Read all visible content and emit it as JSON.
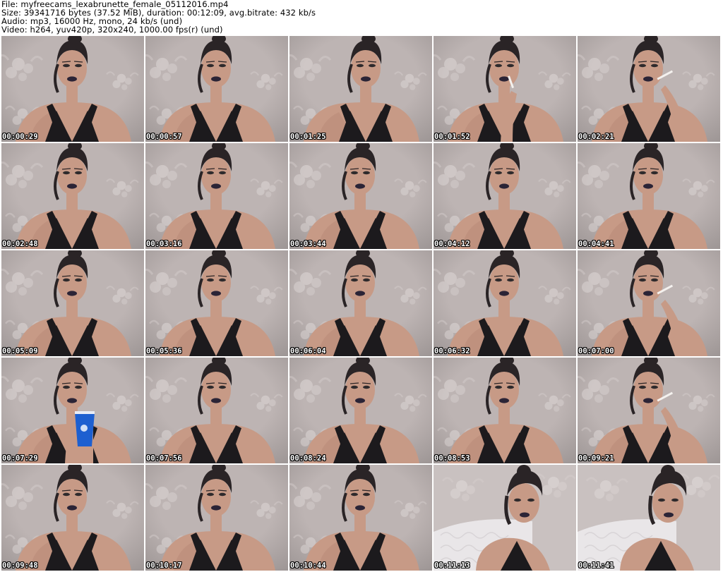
{
  "header": {
    "file_line": "File: myfreecams_lexabrunette_female_05112016.mp4",
    "size_line": "Size: 39341716 bytes (37.52 MiB), duration: 00:12:09, avg.bitrate: 432 kb/s",
    "audio_line": "Audio: mp3, 16000 Hz, mono, 24 kb/s (und)",
    "video_line": "Video: h264, yuv420p, 320x240, 1000.00 fps(r) (und)"
  },
  "colors": {
    "wall": "#bdb4b3",
    "wall_dark": "#a89e9c",
    "skin": "#c79a86",
    "skin_shadow": "#a77866",
    "hair": "#2a2426",
    "top": "#1c1a1d",
    "lips": "#2b2436",
    "headboard": "#e9e6e8",
    "cup": "#1d5fd0"
  },
  "thumbnails": [
    {
      "time": "00:00:29",
      "variant": "base"
    },
    {
      "time": "00:00:57",
      "variant": "base"
    },
    {
      "time": "00:01:25",
      "variant": "right"
    },
    {
      "time": "00:01:52",
      "variant": "smoke-left"
    },
    {
      "time": "00:02:21",
      "variant": "smoke-right"
    },
    {
      "time": "00:02:48",
      "variant": "base"
    },
    {
      "time": "00:03:16",
      "variant": "base"
    },
    {
      "time": "00:03:44",
      "variant": "base"
    },
    {
      "time": "00:04:12",
      "variant": "base"
    },
    {
      "time": "00:04:41",
      "variant": "base"
    },
    {
      "time": "00:05:09",
      "variant": "base"
    },
    {
      "time": "00:05:36",
      "variant": "base"
    },
    {
      "time": "00:06:04",
      "variant": "base"
    },
    {
      "time": "00:06:32",
      "variant": "base"
    },
    {
      "time": "00:07:00",
      "variant": "smoke-right"
    },
    {
      "time": "00:07:29",
      "variant": "cup"
    },
    {
      "time": "00:07:56",
      "variant": "base"
    },
    {
      "time": "00:08:24",
      "variant": "base"
    },
    {
      "time": "00:08:53",
      "variant": "base"
    },
    {
      "time": "00:09:21",
      "variant": "smoke-right"
    },
    {
      "time": "00:09:48",
      "variant": "base"
    },
    {
      "time": "00:10:17",
      "variant": "base"
    },
    {
      "time": "00:10:44",
      "variant": "base"
    },
    {
      "time": "00:11:13",
      "variant": "bed"
    },
    {
      "time": "00:11:41",
      "variant": "bed"
    }
  ]
}
